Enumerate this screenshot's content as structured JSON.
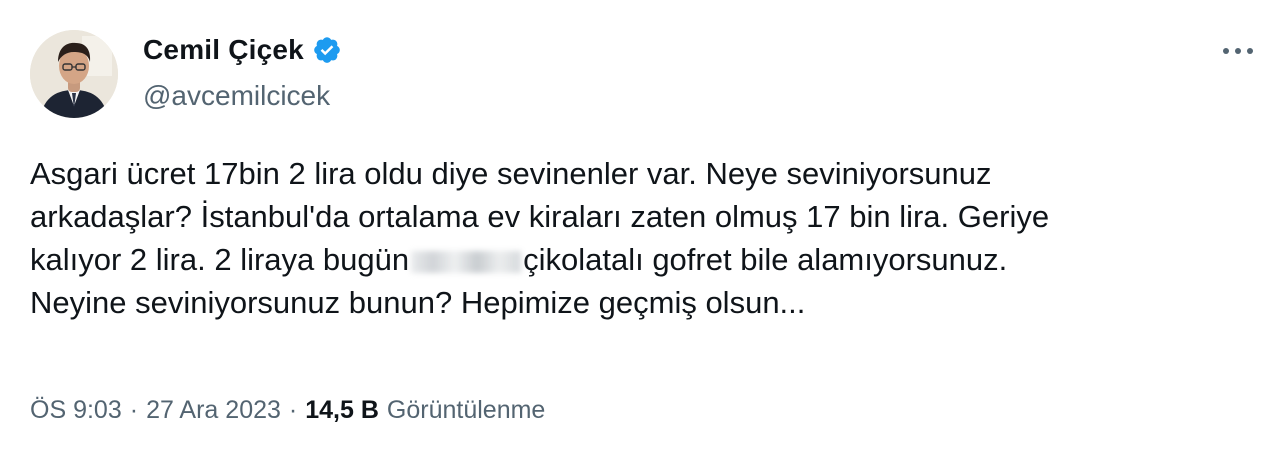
{
  "author": {
    "display_name": "Cemil Çiçek",
    "handle": "@avcemilcicek",
    "verified": true
  },
  "tweet": {
    "lines": [
      "Asgari ücret 17bin 2 lira oldu diye sevinenler var. Neye seviniyorsunuz",
      "arkadaşlar? İstanbul'da ortalama ev kiraları zaten olmuş 17 bin lira. Geriye",
      "kalıyor 2 lira. 2 liraya bugün",
      "çikolatalı gofret bile alamıyorsunuz.",
      "Neyine seviniyorsunuz bunun? Hepimize geçmiş olsun..."
    ]
  },
  "meta": {
    "time": "ÖS 9:03",
    "separator": "·",
    "date": "27 Ara 2023",
    "views_count": "14,5 B",
    "views_label": "Görüntülenme"
  },
  "colors": {
    "text": "#0f1419",
    "secondary": "#536471",
    "verified": "#1d9bf0"
  },
  "icons": {
    "verified": "verified-badge-icon",
    "more": "more-horizontal-icon"
  }
}
